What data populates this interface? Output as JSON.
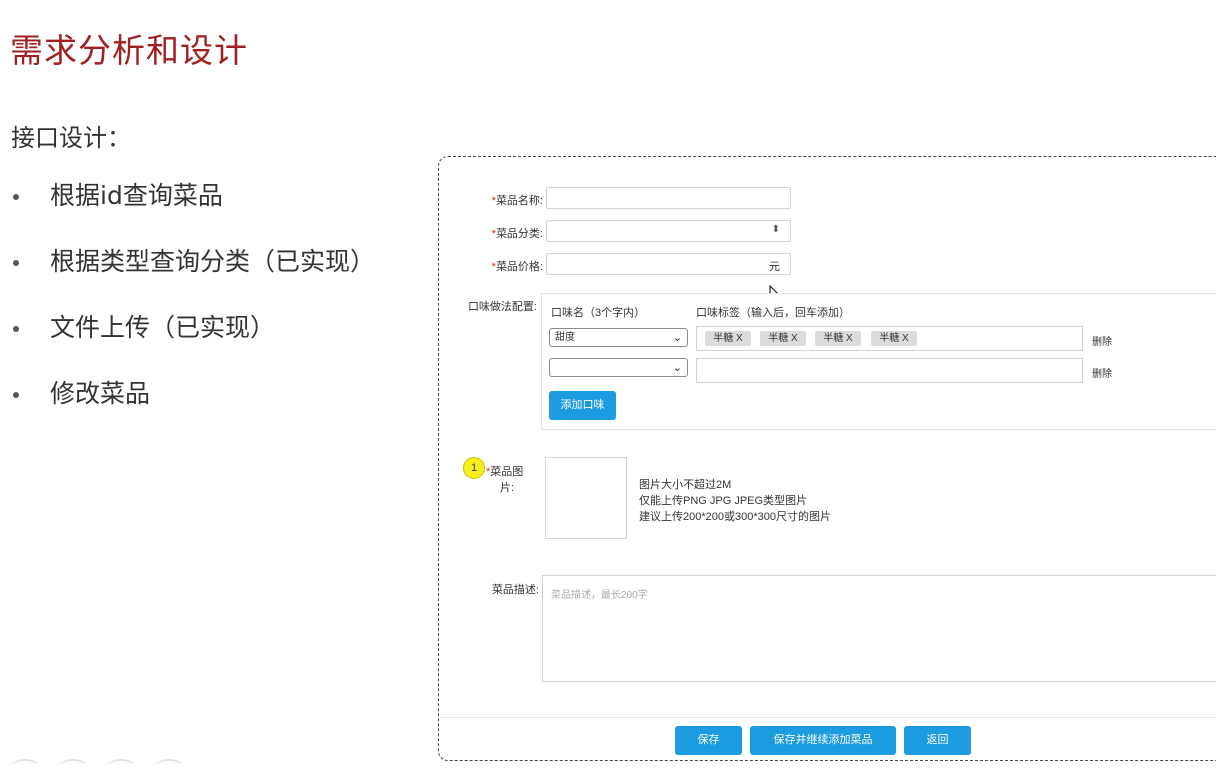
{
  "slide": {
    "title": "需求分析和设计",
    "section_heading": "接口设计：",
    "bullets": [
      "根据id查询菜品",
      "根据类型查询分类（已实现）",
      "文件上传（已实现）",
      "修改菜品"
    ]
  },
  "form": {
    "name_label": "菜品名称:",
    "category_label": "菜品分类:",
    "price_label": "菜品价格:",
    "price_unit": "元",
    "flavor_label": "口味做法配置:",
    "flavor_name_header": "口味名（3个字内）",
    "flavor_tags_header": "口味标签（输入后，回车添加）",
    "flavor_rows": [
      {
        "name": "甜度",
        "tags": [
          "半糖 X",
          "半糖 X",
          "半糖 X",
          "半糖 X"
        ],
        "delete_label": "删除"
      },
      {
        "name": "",
        "tags": [],
        "delete_label": "删除"
      }
    ],
    "add_flavor_button": "添加口味",
    "image_badge": "1",
    "image_label_line1": "菜品图",
    "image_label_line2": "片:",
    "image_hints": [
      "图片大小不超过2M",
      "仅能上传PNG JPG JPEG类型图片",
      "建议上传200*200或300*300尺寸的图片"
    ],
    "description_label": "菜品描述:",
    "description_placeholder": "菜品描述，最长200字",
    "buttons": {
      "save": "保存",
      "save_continue": "保存并继续添加菜品",
      "back": "返回"
    }
  },
  "colors": {
    "title_red": "#a11f1f",
    "primary_blue": "#1b9be0",
    "required_red": "#e0241a",
    "badge_yellow": "#f5ee1c"
  }
}
